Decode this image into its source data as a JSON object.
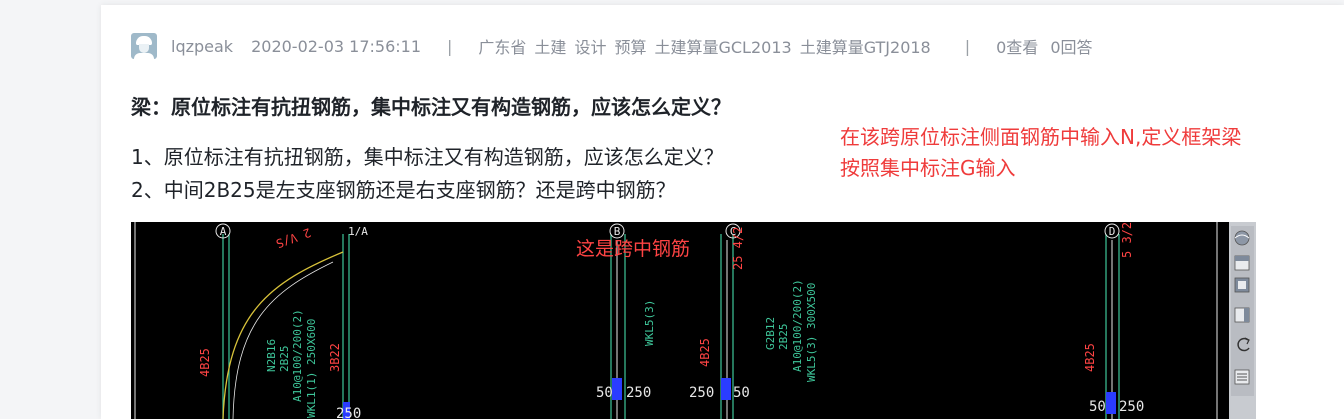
{
  "post": {
    "user": "lqzpeak",
    "date": "2020-02-03 17:56:11",
    "separator": "|",
    "tags": [
      "广东省",
      "土建",
      "设计",
      "预算",
      "土建算量GCL2013",
      "土建算量GTJ2018"
    ],
    "views": "0查看",
    "answers": "0回答",
    "title": "梁：原位标注有抗扭钢筋，集中标注又有构造钢筋，应该怎么定义？",
    "question_1": "1、原位标注有抗扭钢筋，集中标注又有构造钢筋，应该怎么定义？",
    "question_2": "2、中间2B25是左支座钢筋还是右支座钢筋？还是跨中钢筋？",
    "answer_line_1": "在该跨原位标注侧面钢筋中输入N,定义框架梁",
    "answer_line_2": "按照集中标注G输入"
  },
  "cad": {
    "annotation": "这是跨中钢筋",
    "axis_labels": [
      "A",
      "1/A",
      "B",
      "C",
      "D"
    ],
    "labels_green": [
      "WKL1(1) 250X600",
      "A10@100/200(2)",
      "2B25",
      "N2B16",
      "WKL5(3)",
      "WKL5(3) 300X500",
      "A10@100/200(2)",
      "2B25",
      "G2B12",
      "WKL5(3)"
    ],
    "labels_red": [
      "4B25",
      "3B22",
      "4B25",
      "4B25",
      "25 4/2",
      "5 3/2",
      "2 V/S"
    ],
    "dims": [
      "250",
      "50",
      "250",
      "250",
      "50",
      "50",
      "250"
    ],
    "colors": {
      "bg": "#000000",
      "green": "#3ec69a",
      "red": "#ff4444",
      "yellow": "#d8c23a",
      "white": "#e8e8e8",
      "blue": "#2a3cff",
      "toolbar": "#c8cbd0"
    },
    "toolbar_icons": [
      "orbit-icon",
      "box-top-icon",
      "box-front-icon",
      "box-side-icon",
      "rotate-icon",
      "layers-icon"
    ]
  }
}
